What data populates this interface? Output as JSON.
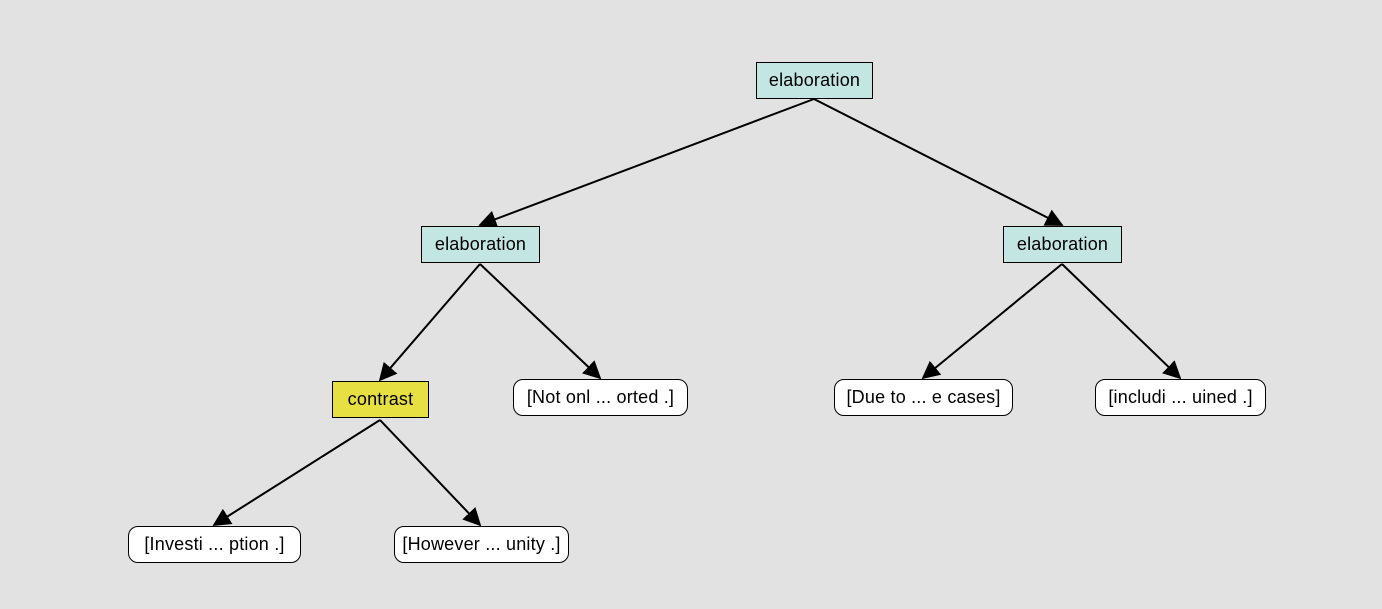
{
  "colors": {
    "canvas_bg": "#e2e2e2",
    "relation_fill": "#c4e6e3",
    "contrast_fill": "#e7e042",
    "leaf_fill": "#ffffff",
    "edge": "#000000"
  },
  "nodes": {
    "root": {
      "label": "elaboration",
      "kind": "relation"
    },
    "left": {
      "label": "elaboration",
      "kind": "relation"
    },
    "right": {
      "label": "elaboration",
      "kind": "relation"
    },
    "contrast": {
      "label": "contrast",
      "kind": "contrast"
    },
    "leaf_notonl": {
      "label": "[Not onl ... orted .]",
      "kind": "leaf"
    },
    "leaf_due": {
      "label": "[Due to  ... e cases]",
      "kind": "leaf"
    },
    "leaf_incl": {
      "label": "[includi ... uined .]",
      "kind": "leaf"
    },
    "leaf_inv": {
      "label": "[Investi ... ption .]",
      "kind": "leaf"
    },
    "leaf_how": {
      "label": "[However ... unity .]",
      "kind": "leaf"
    }
  },
  "edges": [
    {
      "from": "root",
      "to": "left"
    },
    {
      "from": "root",
      "to": "right"
    },
    {
      "from": "left",
      "to": "contrast"
    },
    {
      "from": "left",
      "to": "leaf_notonl"
    },
    {
      "from": "right",
      "to": "leaf_due"
    },
    {
      "from": "right",
      "to": "leaf_incl"
    },
    {
      "from": "contrast",
      "to": "leaf_inv"
    },
    {
      "from": "contrast",
      "to": "leaf_how"
    }
  ]
}
